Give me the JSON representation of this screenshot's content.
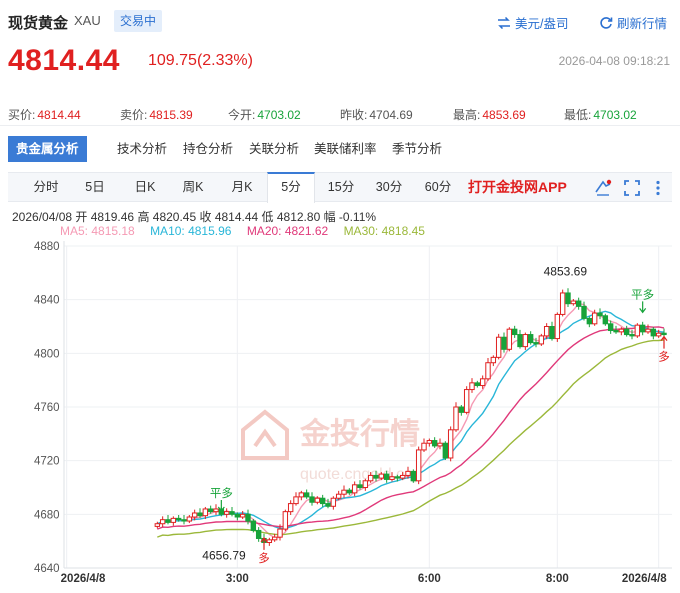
{
  "header": {
    "title": "现货黄金",
    "code": "XAU",
    "status": "交易中",
    "unit_link": "美元/盎司",
    "refresh_link": "刷新行情"
  },
  "price": {
    "last": "4814.44",
    "change": "109.75(2.33%)",
    "timestamp": "2026-04-08 09:18:21"
  },
  "quote": {
    "bid_label": "买价:",
    "bid": "4814.44",
    "ask_label": "卖价:",
    "ask": "4815.39",
    "open_label": "今开:",
    "open": "4703.02",
    "prev_label": "昨收:",
    "prev": "4704.69",
    "high_label": "最高:",
    "high": "4853.69",
    "low_label": "最低:",
    "low": "4703.02"
  },
  "tabs": [
    "贵金属分析",
    "技术分析",
    "持仓分析",
    "关联分析",
    "美联储利率",
    "季节分析"
  ],
  "periods": [
    "分时",
    "5日",
    "日K",
    "周K",
    "月K",
    "5分",
    "15分",
    "30分",
    "60分"
  ],
  "active_period": "5分",
  "app_link": "打开金投网APP",
  "toolbar_icons": [
    "draw-tool-icon",
    "fullscreen-icon",
    "more-icon"
  ],
  "bar_info": "2026/04/08  开 4819.46  高 4820.45  收 4814.44  低 4812.80  幅 -0.11%",
  "ma": {
    "ma5": "MA5: 4815.18",
    "ma10": "MA10: 4815.96",
    "ma20": "MA20: 4821.62",
    "ma30": "MA30: 4818.45"
  },
  "colors": {
    "up": "#e02020",
    "down": "#17a33a",
    "ma5": "#f59ab4",
    "ma10": "#29b6d8",
    "ma20": "#e0397a",
    "ma30": "#9bb83a",
    "accent": "#3a7bd5"
  },
  "watermark": {
    "brand": "金投行情",
    "url": "quote.cngold.org"
  },
  "chart_data": {
    "type": "candlestick",
    "ylim": [
      4640,
      4880
    ],
    "y_ticks": [
      4640,
      4680,
      4720,
      4760,
      4800,
      4840,
      4880
    ],
    "x_ticks": [
      {
        "label": "2026/4/8",
        "index": 0
      },
      {
        "label": "3:00",
        "index": 32
      },
      {
        "label": "6:00",
        "index": 68
      },
      {
        "label": "8:00",
        "index": 92
      },
      {
        "label": "2026/4/8",
        "index": 111
      }
    ],
    "annotations": [
      {
        "text": "4853.69",
        "index": 95,
        "value": 4853.69,
        "kind": "high"
      },
      {
        "text": "4656.79",
        "index": 31,
        "value": 4656.79,
        "kind": "low"
      },
      {
        "text": "平多",
        "index": 29,
        "value": 4687,
        "kind": "flat-long"
      },
      {
        "text": "多",
        "index": 37,
        "value": 4658,
        "kind": "long"
      },
      {
        "text": "平多",
        "index": 108,
        "value": 4835,
        "kind": "flat-long"
      },
      {
        "text": "多",
        "index": 112,
        "value": 4808,
        "kind": "long"
      }
    ],
    "closes": [
      4673,
      4676,
      4674,
      4677,
      4676,
      4675,
      4678,
      4681,
      4679,
      4684,
      4682,
      4684,
      4680,
      4682,
      4680,
      4678,
      4680,
      4675,
      4668,
      4662,
      4659,
      4661,
      4663,
      4669,
      4682,
      4688,
      4693,
      4696,
      4693,
      4689,
      4692,
      4688,
      4686,
      4692,
      4695,
      4698,
      4696,
      4702,
      4700,
      4705,
      4709,
      4707,
      4710,
      4706,
      4708,
      4707,
      4709,
      4712,
      4705,
      4728,
      4733,
      4735,
      4731,
      4733,
      4722,
      4743,
      4760,
      4756,
      4773,
      4778,
      4776,
      4781,
      4793,
      4797,
      4812,
      4803,
      4818,
      4814,
      4805,
      4814,
      4808,
      4807,
      4813,
      4820,
      4811,
      4829,
      4845,
      4837,
      4839,
      4835,
      4826,
      4822,
      4830,
      4828,
      4822,
      4817,
      4816,
      4818,
      4814,
      4813,
      4821,
      4816,
      4818,
      4813,
      4815,
      4814
    ],
    "ma_source": "computed from closes"
  }
}
